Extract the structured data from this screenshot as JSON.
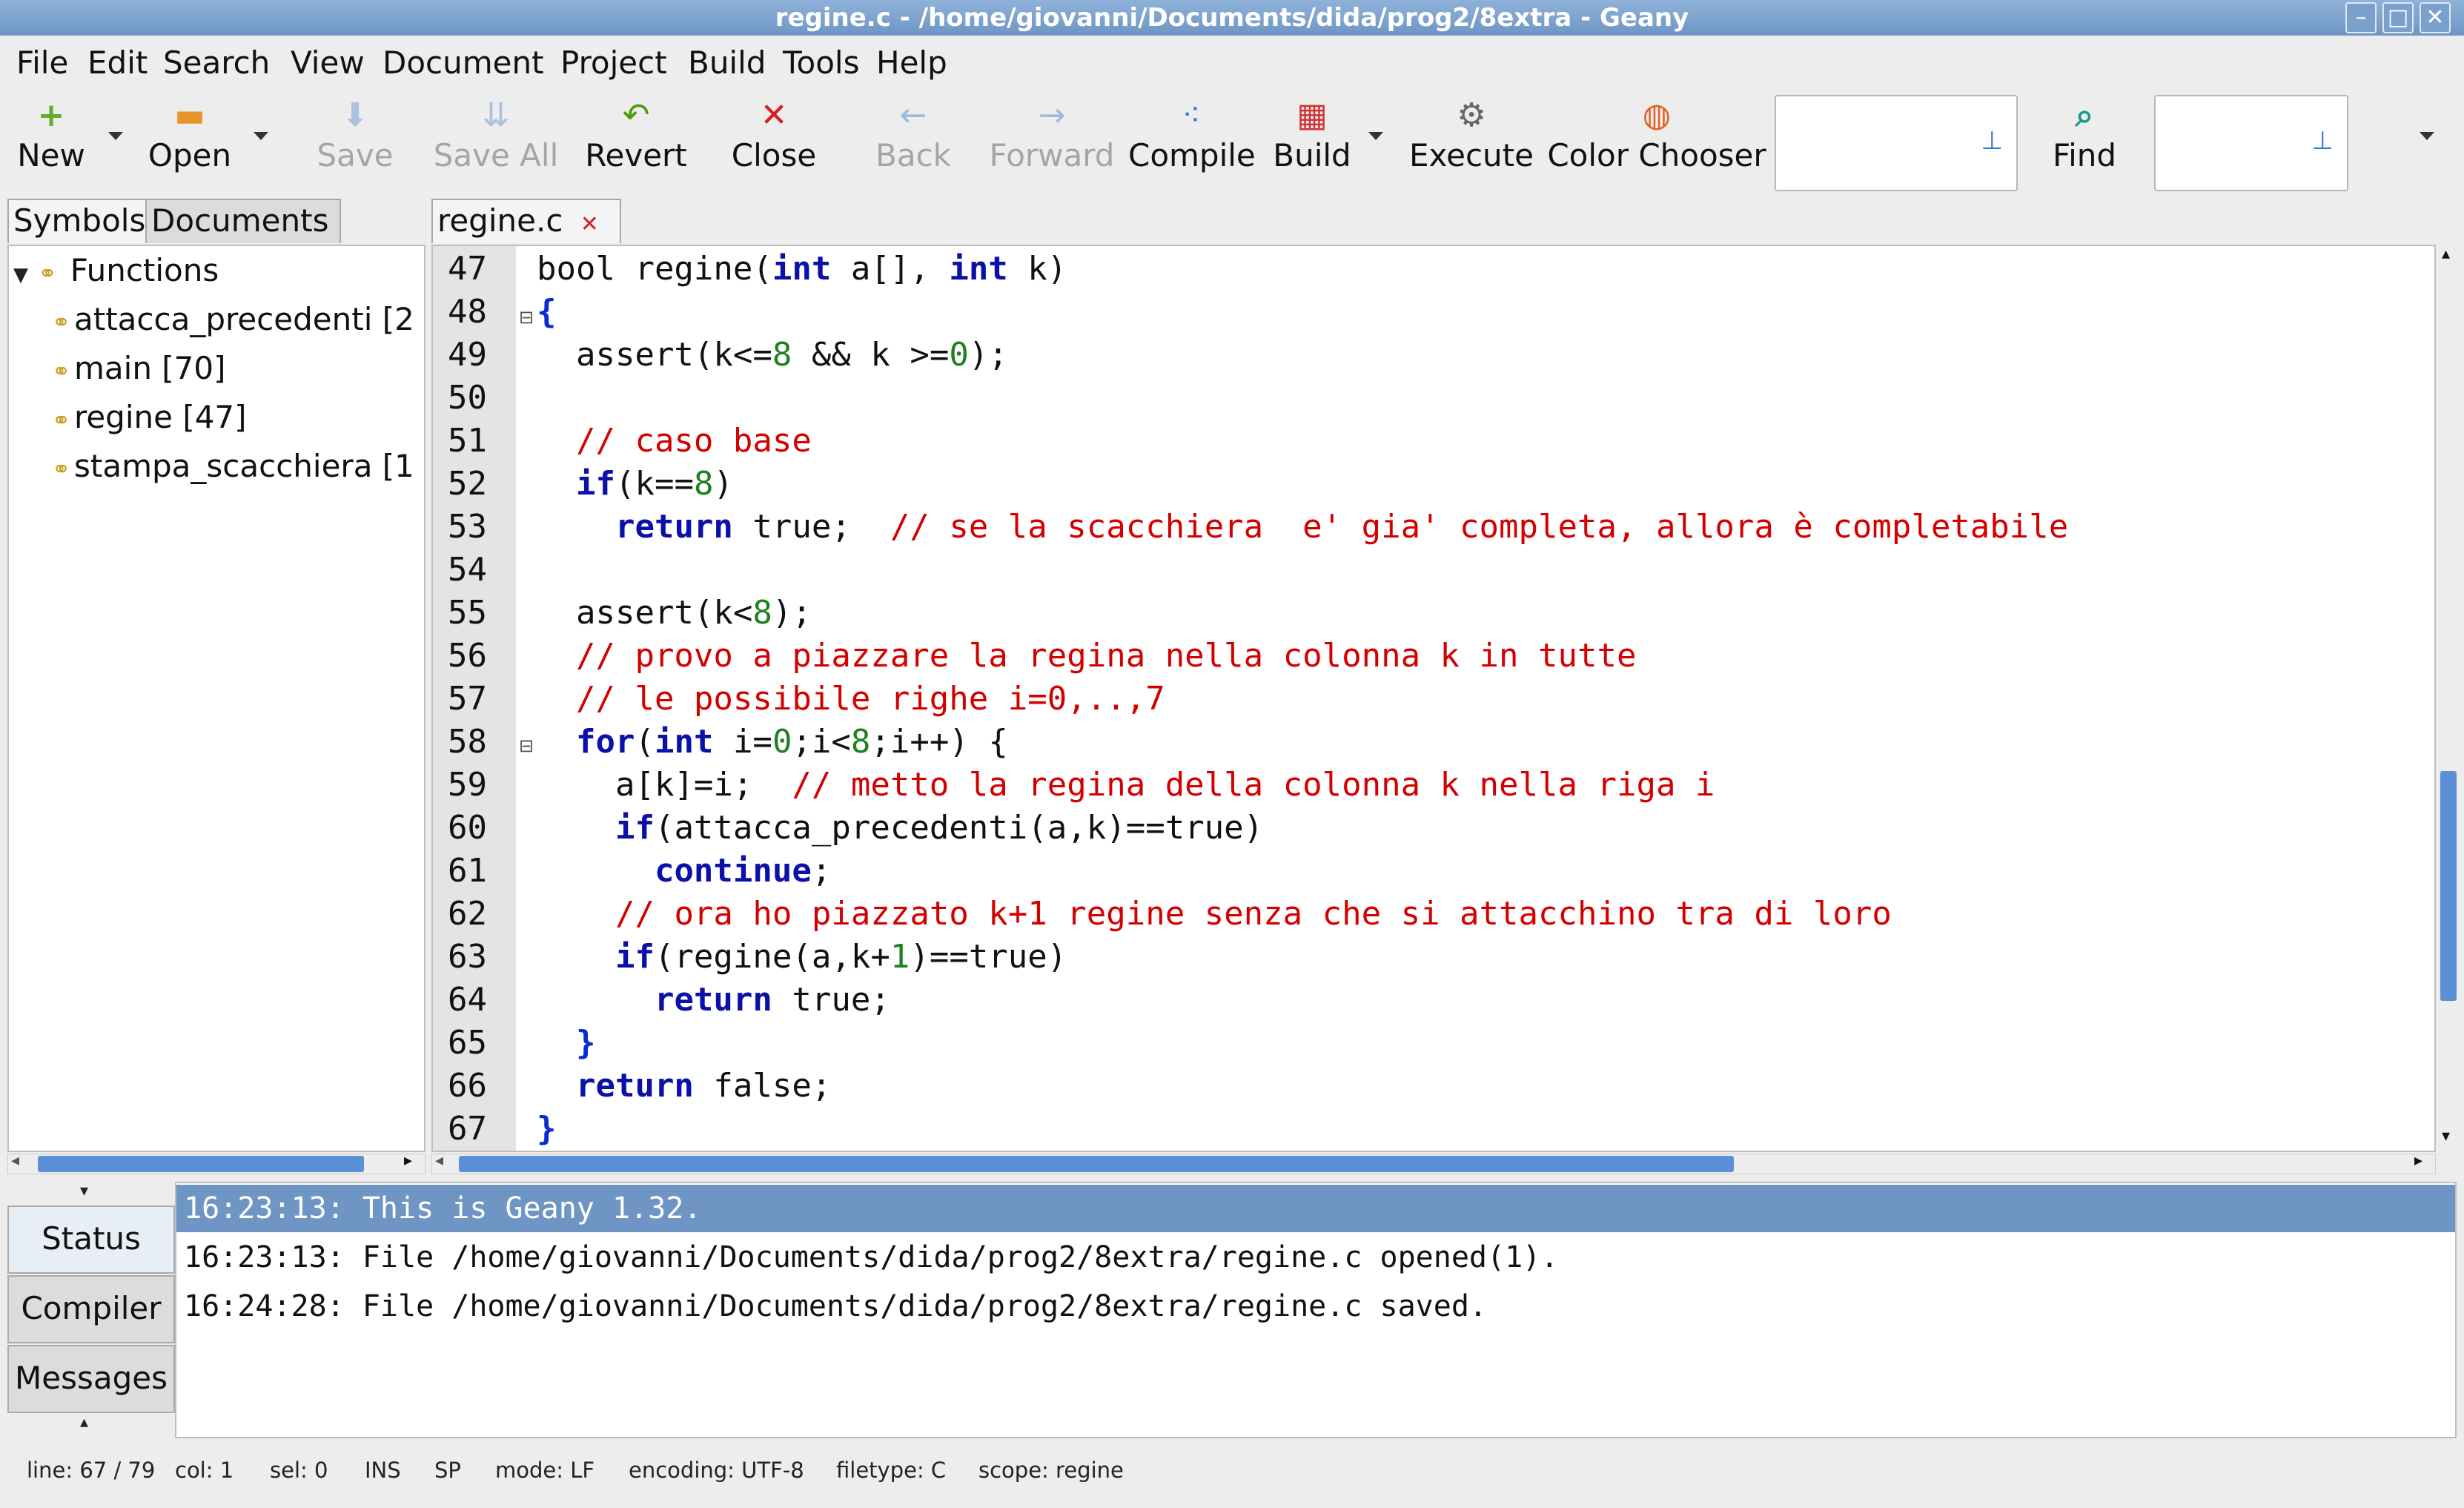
{
  "window": {
    "title": "regine.c - /home/giovanni/Documents/dida/prog2/8extra - Geany"
  },
  "menu": [
    "File",
    "Edit",
    "Search",
    "View",
    "Document",
    "Project",
    "Build",
    "Tools",
    "Help"
  ],
  "toolbar": {
    "new": "New",
    "open": "Open",
    "save": "Save",
    "save_all": "Save All",
    "revert": "Revert",
    "close": "Close",
    "back": "Back",
    "forward": "Forward",
    "compile": "Compile",
    "build": "Build",
    "execute": "Execute",
    "color_chooser": "Color Chooser",
    "find": "Find"
  },
  "sidebar": {
    "tabs": [
      "Symbols",
      "Documents"
    ],
    "group": "Functions",
    "items": [
      "attacca_precedenti [2",
      "main [70]",
      "regine [47]",
      "stampa_scacchiera [1"
    ]
  },
  "editor": {
    "tab": "regine.c",
    "lines": [
      {
        "n": "47",
        "t": "bool regine(int a[], int k)"
      },
      {
        "n": "48",
        "t": "{"
      },
      {
        "n": "49",
        "t": "  assert(k<=8 && k >=0);"
      },
      {
        "n": "50",
        "t": ""
      },
      {
        "n": "51",
        "t": "  // caso base"
      },
      {
        "n": "52",
        "t": "  if(k==8)"
      },
      {
        "n": "53",
        "t": "    return true;  // se la scacchiera  e' gia' completa, allora è completabile"
      },
      {
        "n": "54",
        "t": ""
      },
      {
        "n": "55",
        "t": "  assert(k<8);"
      },
      {
        "n": "56",
        "t": "  // provo a piazzare la regina nella colonna k in tutte"
      },
      {
        "n": "57",
        "t": "  // le possibile righe i=0,..,7"
      },
      {
        "n": "58",
        "t": "  for(int i=0;i<8;i++) {"
      },
      {
        "n": "59",
        "t": "    a[k]=i;  // metto la regina della colonna k nella riga i"
      },
      {
        "n": "60",
        "t": "    if(attacca_precedenti(a,k)==true)"
      },
      {
        "n": "61",
        "t": "      continue;"
      },
      {
        "n": "62",
        "t": "    // ora ho piazzato k+1 regine senza che si attacchino tra di loro"
      },
      {
        "n": "63",
        "t": "    if(regine(a,k+1)==true)"
      },
      {
        "n": "64",
        "t": "      return true;"
      },
      {
        "n": "65",
        "t": "  }"
      },
      {
        "n": "66",
        "t": "  return false;"
      },
      {
        "n": "67",
        "t": "}"
      }
    ]
  },
  "messages": {
    "tabs": [
      "Status",
      "Compiler",
      "Messages"
    ],
    "lines": [
      "16:23:13: This is Geany 1.32.",
      "16:23:13: File /home/giovanni/Documents/dida/prog2/8extra/regine.c opened(1).",
      "16:24:28: File /home/giovanni/Documents/dida/prog2/8extra/regine.c saved."
    ]
  },
  "statusbar": {
    "line": "line: 67 / 79",
    "col": "col: 1",
    "sel": "sel: 0",
    "ins": "INS",
    "sp": "SP",
    "mode": "mode: LF",
    "encoding": "encoding: UTF-8",
    "filetype": "filetype: C",
    "scope": "scope: regine"
  },
  "colors": {
    "keyword": "#0b10a8",
    "number": "#208020",
    "comment": "#d40000",
    "selection": "#6e95c4"
  },
  "icons": {
    "new": "plus-icon",
    "open": "folder-icon",
    "save": "save-icon",
    "revert": "revert-icon",
    "close": "close-icon",
    "back": "back-arrow-icon",
    "forward": "forward-arrow-icon",
    "compile": "compile-icon",
    "build": "build-icon",
    "execute": "gears-icon",
    "color_chooser": "color-wheel-icon",
    "find": "magnifier-icon"
  }
}
